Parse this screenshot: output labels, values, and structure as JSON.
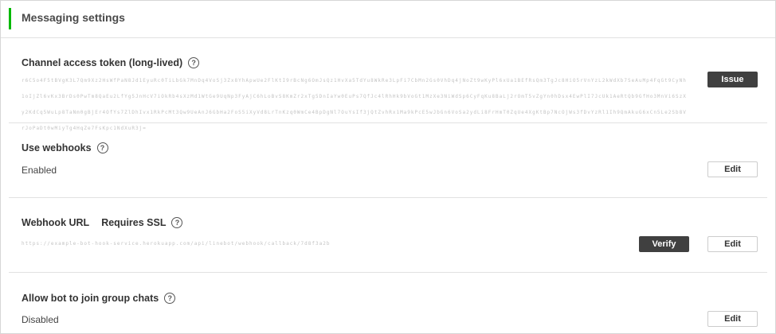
{
  "header": {
    "title": "Messaging settings"
  },
  "channel_token": {
    "label": "Channel access token (long-lived)",
    "value": "r6C5o4F5tBVgK3L7Qm9Xz2HsWfPaN8Jd1EyuRc0TiLbGk7MnDq4VoSj3Zx8YhApwUe2FlKtI9rBcNg6OmJsQz1HvXa5TdYu8WkRe3LpFi7CbMn2Gs0VhDq4jNoZt9wKyPl6xUa1BEfRsQm3TgJc8HiO5rVnYzL2kWdXb7SeAuMp4FqGt9CyNh1oIjZl6vKx3BrDs0PwTm8QaEu2LfYg5JnHcV7iOkRb4sXzMd1WtGe9UqNp3FyAjC6hLoBvS8KmZr2xTg5DnIaYw0EuPs7QfJc4lRhHk9bVoGt1MzXe3NiWdSp6CyFqKu8BaLj2rOmT5vZgYn0hDsx4EwPlI7JcUk1AeRtQb9GfHo3MnVi6SzXy2KdCq5WuLp8TaNm0gBjEr4OfYs7ZlDhIvx1RkPcMt3Qw9UeAnJ6GbHa2FoS5iXyVd8LrTnKzq0WmCe4BpDgNl7OuYsIf3jQtZvhRx1Ma9kPcE5wJbGn6VoSa2ydLi8FrHmT0ZqUe4XgKtBp7NcOjWs3fDvYzRl1Ih9QmAkuG6xCn5Le2Sb8VrJoPaDt0wMiyTg4HqZe7FsKpc1NdXuR3j=",
    "issue_label": "Issue"
  },
  "webhooks": {
    "label": "Use webhooks",
    "status": "Enabled",
    "edit_label": "Edit"
  },
  "webhook_url": {
    "label": "Webhook URL",
    "requires": "Requires SSL",
    "url": "https://example-bot-hook-service.herokuapp.com/api/linebot/webhook/callback/7d8f3a2b",
    "verify_label": "Verify",
    "edit_label": "Edit"
  },
  "group_chats": {
    "label": "Allow bot to join group chats",
    "status": "Disabled",
    "edit_label": "Edit"
  },
  "help_glyph": "?",
  "colors": {
    "accent": "#00b900",
    "dark_button": "#404040"
  }
}
